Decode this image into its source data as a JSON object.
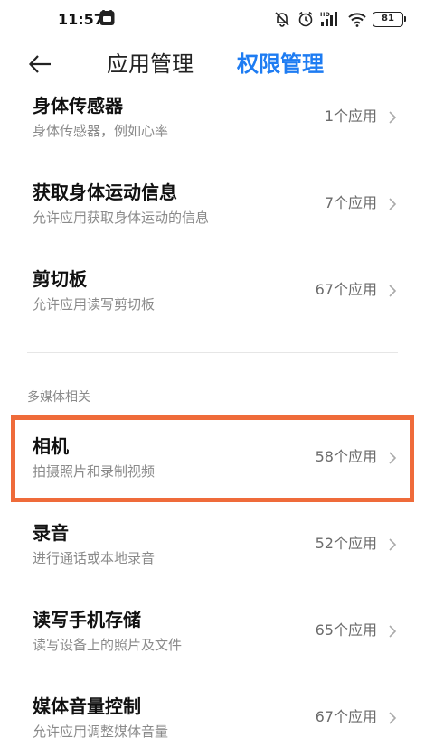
{
  "status_bar": {
    "time": "11:57",
    "app_icon": "mi-app-icon",
    "icons": [
      "mute-bell-icon",
      "alarm-icon",
      "hd-signal-icon",
      "wifi-icon"
    ],
    "battery_level": "81"
  },
  "header": {
    "back_icon": "back-arrow-icon",
    "tabs": [
      {
        "label": "应用管理",
        "active": false
      },
      {
        "label": "权限管理",
        "active": true
      }
    ],
    "active_color": "#1e7cf2"
  },
  "sections": [
    {
      "items": [
        {
          "title": "身体传感器",
          "desc": "身体传感器，例如心率",
          "count": "1个应用"
        },
        {
          "title": "获取身体运动信息",
          "desc": "允许应用获取身体运动的信息",
          "count": "7个应用"
        },
        {
          "title": "剪切板",
          "desc": "允许应用读写剪切板",
          "count": "67个应用"
        }
      ]
    },
    {
      "header": "多媒体相关",
      "items": [
        {
          "title": "相机",
          "desc": "拍摄照片和录制视频",
          "count": "58个应用"
        },
        {
          "title": "录音",
          "desc": "进行通话或本地录音",
          "count": "52个应用"
        },
        {
          "title": "读写手机存储",
          "desc": "读写设备上的照片及文件",
          "count": "65个应用"
        },
        {
          "title": "媒体音量控制",
          "desc": "允许应用调整媒体音量",
          "count": "67个应用"
        }
      ]
    }
  ],
  "highlight_color": "#ef6b3a"
}
